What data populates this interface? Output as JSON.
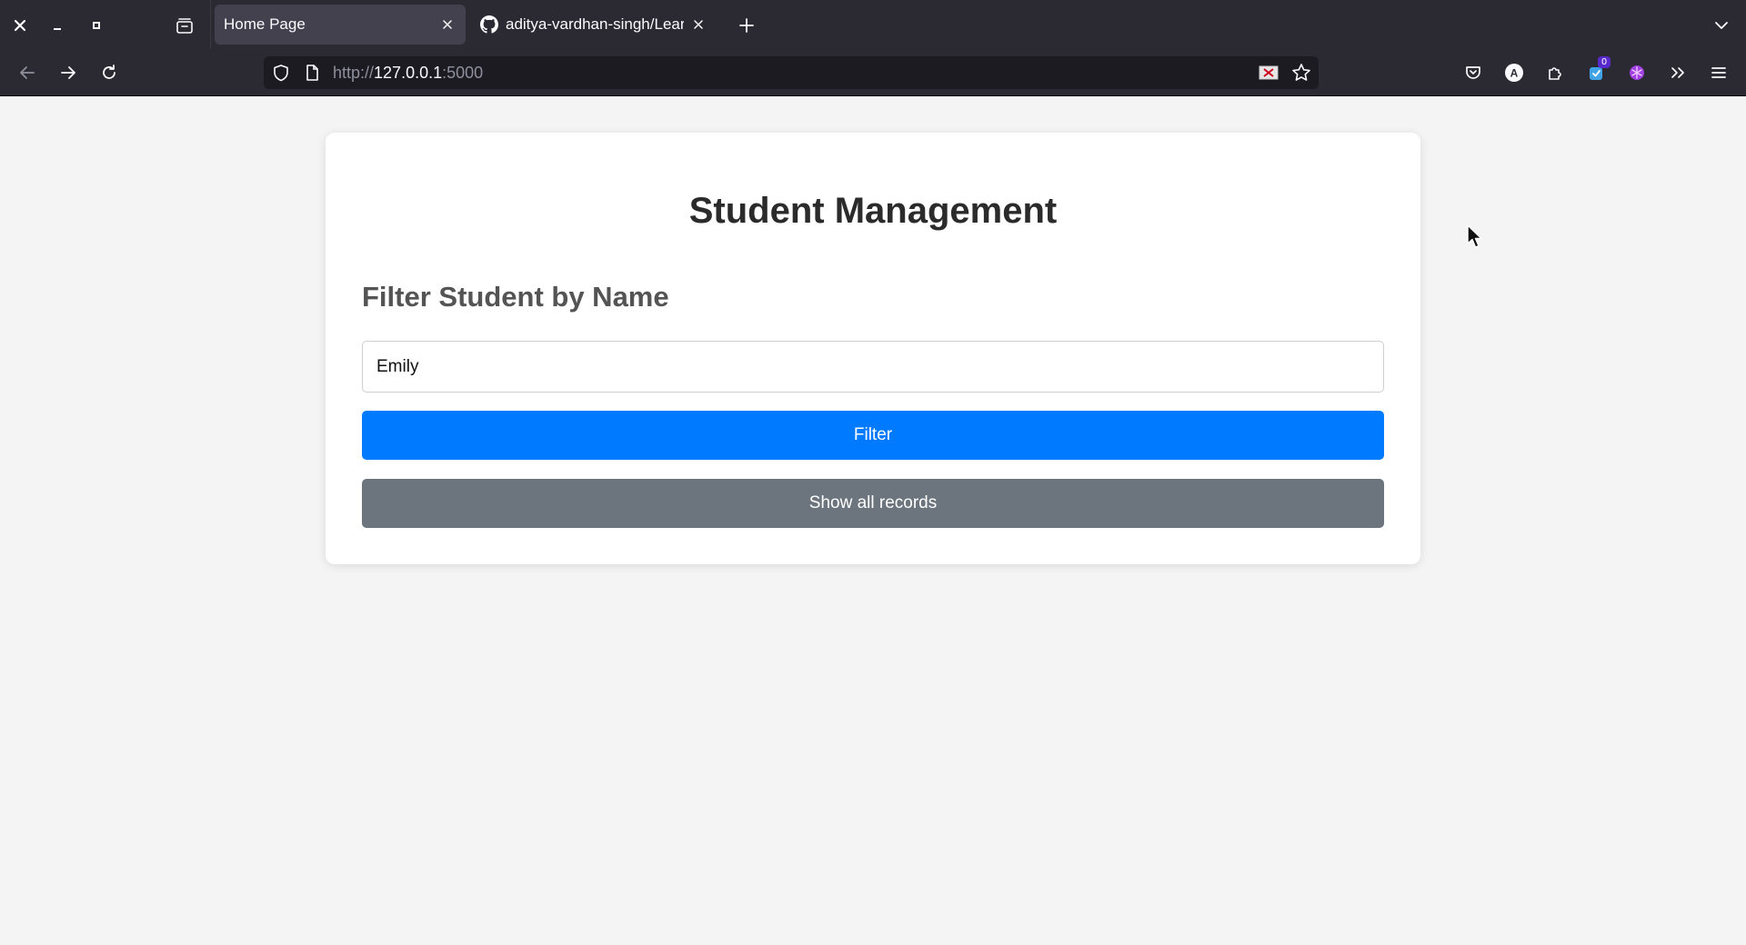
{
  "browser": {
    "tabs": [
      {
        "title": "Home Page",
        "active": true
      },
      {
        "title": "aditya-vardhan-singh/Learn",
        "active": false
      }
    ],
    "url": {
      "prefix": "http://",
      "host": "127.0.0.1",
      "suffix": ":5000"
    },
    "addon_badge": "0",
    "account_initial": "A",
    "icons": {
      "window_close": "close-icon",
      "window_minimize": "minimize-icon",
      "window_maximize": "maximize-icon",
      "tab_list": "tab-list-icon",
      "new_tab": "plus-icon",
      "all_tabs": "chevron-down-icon",
      "back": "arrow-left-icon",
      "forward": "arrow-right-icon",
      "reload": "reload-icon",
      "tracking": "shield-icon",
      "page": "page-icon",
      "star": "star-icon",
      "pocket": "pocket-icon",
      "extensions": "puzzle-icon",
      "overflow": "double-chevron-icon",
      "menu": "hamburger-icon"
    },
    "colors": {
      "chrome": "#2b2a33",
      "active_tab": "#42414d",
      "urlbar": "#1c1b22"
    }
  },
  "page": {
    "title": "Student Management",
    "section_title": "Filter Student by Name",
    "name_input_value": "Emily",
    "filter_label": "Filter",
    "show_all_label": "Show all records",
    "colors": {
      "filter_button": "#007bff",
      "show_all_button": "#6c757d",
      "background": "#f4f4f4"
    }
  }
}
